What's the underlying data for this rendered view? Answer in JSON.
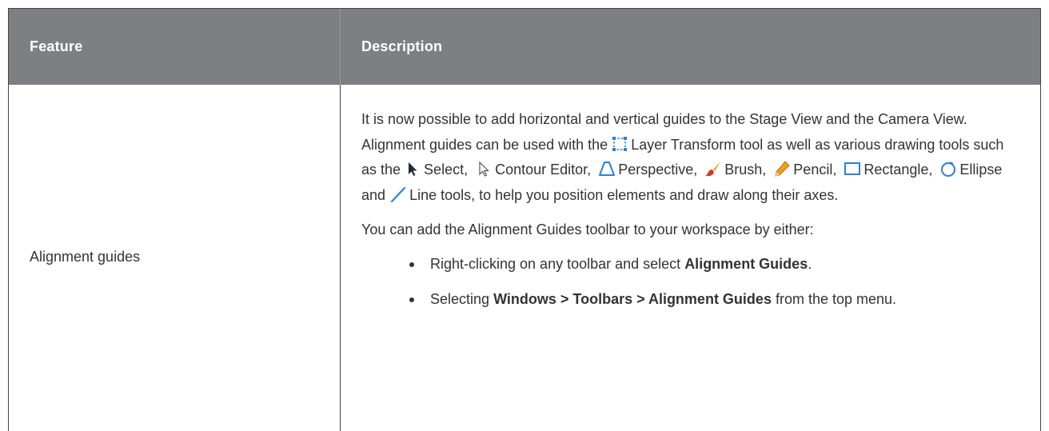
{
  "table": {
    "header": {
      "feature": "Feature",
      "description": "Description"
    },
    "row": {
      "feature": "Alignment guides",
      "p1": {
        "t1": "It is now possible to add horizontal and vertical guides to the Stage View and the Camera View. Alignment guides can be used with the",
        "layer_transform": "Layer Transform",
        "t2": "tool as well as various drawing tools such as the",
        "select": "Select,",
        "contour_editor": "Contour Editor,",
        "perspective": "Perspective,",
        "brush": "Brush,",
        "pencil": "Pencil,",
        "rectangle": "Rectangle,",
        "ellipse": "Ellipse",
        "and": "and",
        "line": "Line tools, to help you position elements and draw along their axes."
      },
      "p2": "You can add the Alignment Guides toolbar to your workspace by either:",
      "bullets": [
        {
          "pre": "Right-clicking on any toolbar and select",
          "bold": "Alignment Guides",
          "post": "."
        },
        {
          "pre": "Selecting",
          "bold": "Windows > Toolbars > Alignment Guides",
          "post": "from the top menu."
        }
      ]
    }
  },
  "icons": {
    "layer_transform": "layer-transform-icon",
    "select": "select-arrow-icon",
    "contour_editor": "contour-editor-icon",
    "perspective": "perspective-icon",
    "brush": "brush-icon",
    "pencil": "pencil-icon",
    "rectangle": "rectangle-icon",
    "ellipse": "ellipse-icon",
    "line": "line-icon"
  },
  "colors": {
    "header_bg": "#7e7f82",
    "header_text": "#ffffff",
    "body_text": "#333333",
    "icon_blue": "#2d7fd3",
    "brush_red": "#d8342a",
    "pencil_orange": "#e8a21c"
  }
}
